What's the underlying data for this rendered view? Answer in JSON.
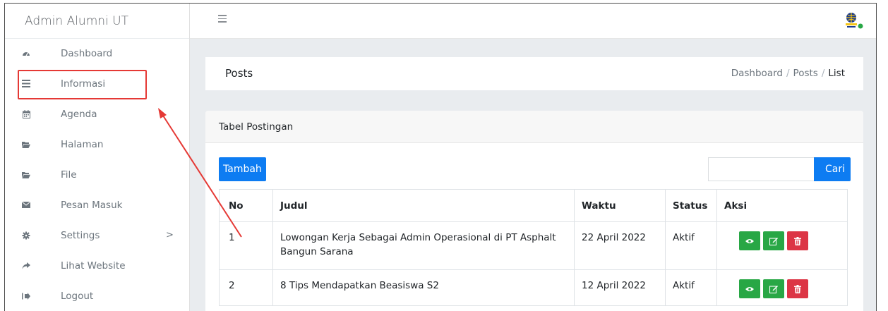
{
  "sidebar": {
    "brand": "Admin Alumni UT",
    "items": [
      {
        "label": "Dashboard",
        "icon": "dashboard-icon"
      },
      {
        "label": "Informasi",
        "icon": "list-icon"
      },
      {
        "label": "Agenda",
        "icon": "calendar-icon"
      },
      {
        "label": "Halaman",
        "icon": "folder-icon"
      },
      {
        "label": "File",
        "icon": "folder-icon"
      },
      {
        "label": "Pesan Masuk",
        "icon": "envelope-icon"
      },
      {
        "label": "Settings",
        "icon": "gear-icon",
        "chevron": ">"
      },
      {
        "label": "Lihat Website",
        "icon": "share-icon"
      },
      {
        "label": "Logout",
        "icon": "sign-out-icon"
      }
    ]
  },
  "topbar": {
    "menu_icon": "hamburger-icon",
    "logo_icon": "logo-icon"
  },
  "header": {
    "title": "Posts",
    "breadcrumb": [
      "Dashboard",
      "Posts",
      "List"
    ]
  },
  "card": {
    "title": "Tabel Postingan",
    "add_button": "Tambah",
    "search_placeholder": "",
    "search_button": "Cari",
    "columns": [
      "No",
      "Judul",
      "Waktu",
      "Status",
      "Aksi"
    ],
    "rows": [
      {
        "no": "1",
        "judul": "Lowongan Kerja Sebagai Admin Operasional di PT Asphalt Bangun Sarana",
        "waktu": "22 April 2022",
        "status": "Aktif"
      },
      {
        "no": "2",
        "judul": "8 Tips Mendapatkan Beasiswa S2",
        "waktu": "12 April 2022",
        "status": "Aktif"
      }
    ]
  },
  "colors": {
    "primary": "#0d7cf2",
    "success": "#28a745",
    "danger": "#dc3545",
    "annotation": "#e53935"
  }
}
